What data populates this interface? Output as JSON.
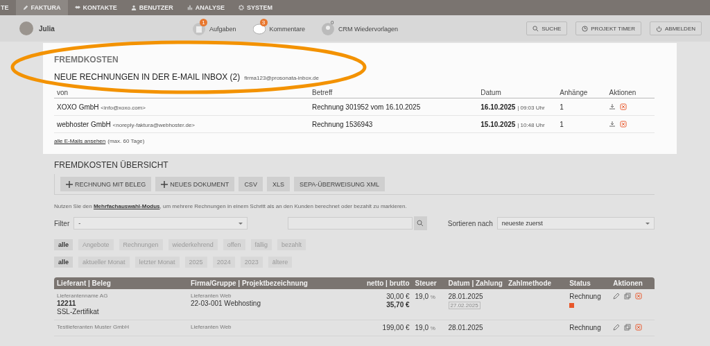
{
  "nav": {
    "tabs": [
      {
        "label": "TE",
        "kind": "none",
        "selected": false
      },
      {
        "label": "FAKTURA",
        "kind": "pencil",
        "selected": true
      },
      {
        "label": "KONTAKTE",
        "kind": "handshake",
        "selected": false
      },
      {
        "label": "BENUTZER",
        "kind": "person",
        "selected": false
      },
      {
        "label": "ANALYSE",
        "kind": "bars",
        "selected": false
      },
      {
        "label": "SYSTEM",
        "kind": "gear",
        "selected": false
      }
    ]
  },
  "toolbar": {
    "user": "Julia",
    "notifications": [
      {
        "label": "Aufgaben",
        "count": "1",
        "kind": "task"
      },
      {
        "label": "Kommentare",
        "count": "3",
        "kind": "comment"
      },
      {
        "label": "CRM Wiedervorlagen",
        "count": "0",
        "kind": "crm"
      }
    ],
    "buttons": [
      {
        "label": "SUCHE",
        "kind": "search"
      },
      {
        "label": "PROJEKT TIMER",
        "kind": "timer"
      },
      {
        "label": "ABMELDEN",
        "kind": "power"
      }
    ]
  },
  "inbox": {
    "section": "FREMDKOSTEN",
    "title": "NEUE RECHNUNGEN IN DER E-MAIL INBOX (2)",
    "address": "firma123@prosonata-inbox.de",
    "columns": [
      "von",
      "Betreff",
      "Datum",
      "Anhänge",
      "Aktionen"
    ],
    "rows": [
      {
        "sender": "XOXO GmbH",
        "email": "<info@xoxo.com>",
        "subject": "Rechnung 301952 vom 16.10.2025",
        "date": "16.10.2025",
        "time": "| 09:03 Uhr",
        "attachments": "1"
      },
      {
        "sender": "webhoster GmbH",
        "email": "<noreply-faktura@webhoster.de>",
        "subject": "Rechnung 1536943",
        "date": "15.10.2025",
        "time": "| 10:48 Uhr",
        "attachments": "1"
      }
    ],
    "link": "alle E-Mails ansehen",
    "link_note": "(max. 60 Tage)"
  },
  "overview": {
    "title": "FREMDKOSTEN ÜBERSICHT",
    "buttons": [
      {
        "label": "RECHNUNG MIT BELEG",
        "kind": "add"
      },
      {
        "label": "NEUES DOKUMENT",
        "kind": "add"
      },
      {
        "label": "CSV",
        "kind": "plain"
      },
      {
        "label": "XLS",
        "kind": "plain"
      },
      {
        "label": "SEPA-ÜBERWEISUNG XML",
        "kind": "plain"
      }
    ],
    "hint_before": "Nutzen Sie den",
    "hint_link": "Mehrfachauswahl-Modus",
    "hint_after": ", um mehrere Rechnungen in einem Schritt als an den Kunden berechnet oder bezahlt zu markieren.",
    "filter": {
      "label": "Filter",
      "value": "-"
    },
    "sort": {
      "label": "Sortieren nach",
      "value": "neueste zuerst"
    },
    "type_chips": [
      {
        "label": "alle",
        "selected": true
      },
      {
        "label": "Angebote",
        "selected": false
      },
      {
        "label": "Rechnungen",
        "selected": false
      },
      {
        "label": "wiederkehrend",
        "selected": false
      },
      {
        "label": "offen",
        "selected": false
      },
      {
        "label": "fällig",
        "selected": false
      },
      {
        "label": "bezahlt",
        "selected": false
      }
    ],
    "period_chips": [
      {
        "label": "alle",
        "selected": true
      },
      {
        "label": "aktueller Monat",
        "selected": false
      },
      {
        "label": "letzter Monat",
        "selected": false
      },
      {
        "label": "2025",
        "selected": false
      },
      {
        "label": "2024",
        "selected": false
      },
      {
        "label": "2023",
        "selected": false
      },
      {
        "label": "ältere",
        "selected": false
      }
    ],
    "columns": [
      "Lieferant | Beleg",
      "Firma/Gruppe | Projektbezeichnung",
      "netto | brutto",
      "Steuer",
      "Datum | Zahlung",
      "Zahlmethode",
      "Status",
      "Aktionen"
    ],
    "rows": [
      {
        "supplier": "Lieferantenname AG",
        "number": "12211",
        "description": "SSL-Zertifikat",
        "group": "Lieferanten Web",
        "project": "22-03-001 Webhosting",
        "net": "30,00 €",
        "gross": "35,70 €",
        "tax": "19,0",
        "tax_unit": "%",
        "date": "28.01.2025",
        "payment": "27.02.2025",
        "status": "Rechnung",
        "color": "#e8572a"
      },
      {
        "supplier": "Testlieferanten Muster GmbH",
        "group": "Lieferanten Web",
        "net": "199,00 €",
        "tax": "19,0",
        "tax_unit": "%",
        "date": "28.01.2025",
        "status": "Rechnung"
      }
    ]
  }
}
